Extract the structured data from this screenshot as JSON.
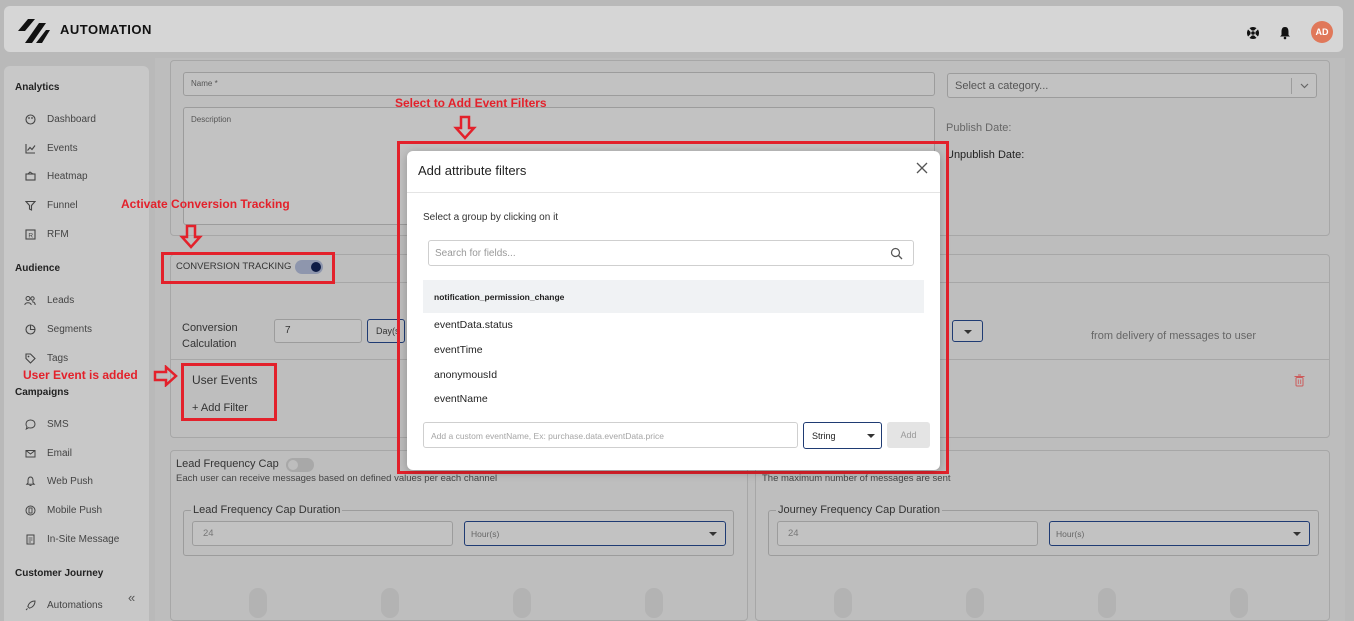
{
  "app": {
    "brand": "AUTOMATION",
    "avatar_initials": "AD"
  },
  "sidebar": {
    "sections": [
      {
        "label": "Analytics",
        "items": [
          {
            "label": "Dashboard",
            "icon": "palette-icon"
          },
          {
            "label": "Events",
            "icon": "line-chart-icon"
          },
          {
            "label": "Heatmap",
            "icon": "heatmap-icon"
          },
          {
            "label": "Funnel",
            "icon": "funnel-icon"
          },
          {
            "label": "RFM",
            "icon": "rfm-icon"
          }
        ]
      },
      {
        "label": "Audience",
        "items": [
          {
            "label": "Leads",
            "icon": "users-icon"
          },
          {
            "label": "Segments",
            "icon": "pie-icon"
          },
          {
            "label": "Tags",
            "icon": "tag-icon"
          }
        ]
      },
      {
        "label": "Campaigns",
        "items": [
          {
            "label": "SMS",
            "icon": "chat-icon"
          },
          {
            "label": "Email",
            "icon": "mail-icon"
          },
          {
            "label": "Web Push",
            "icon": "bell-icon"
          },
          {
            "label": "Mobile Push",
            "icon": "mobile-icon"
          },
          {
            "label": "In-Site Message",
            "icon": "doc-icon"
          }
        ]
      },
      {
        "label": "Customer Journey",
        "items": [
          {
            "label": "Automations",
            "icon": "rocket-icon"
          }
        ]
      }
    ],
    "collapse_glyph": "«"
  },
  "form": {
    "name_label": "Name *",
    "description_label": "Description",
    "category_placeholder": "Select a category...",
    "publish_date_label": "Publish Date:",
    "unpublish_date_label": "Unpublish Date:",
    "conversion_tracking_label": "CONVERSION TRACKING",
    "conversion_calc_label": "Conversion Calculation",
    "conversion_value": "7",
    "conversion_unit": "Day(s",
    "delivery_note": "from delivery of messages to user",
    "user_events_label": "User Events",
    "add_filter_label": "+ Add Filter",
    "lead_cap_title": "Lead Frequency Cap",
    "lead_cap_desc": "Each user can receive messages based on defined values per each channel",
    "journey_cap_desc": "The maximum number of messages are sent",
    "lead_cap_duration_label": "Lead Frequency Cap Duration",
    "journey_cap_duration_label": "Journey Frequency Cap Duration",
    "lead_cap_value": "24",
    "lead_cap_unit": "Hour(s)",
    "journey_cap_value": "24",
    "journey_cap_unit": "Hour(s)"
  },
  "annotations": {
    "select_filters": "Select to Add Event Filters",
    "activate_tracking": "Activate  Conversion Tracking",
    "user_event_added": "User Event is added",
    "color": "#e3212b"
  },
  "modal": {
    "title": "Add attribute filters",
    "subtitle": "Select a group by clicking on it",
    "search_placeholder": "Search for fields...",
    "group": "notification_permission_change",
    "options": [
      "eventData.status",
      "eventTime",
      "anonymousId",
      "eventName"
    ],
    "custom_placeholder": "Add a custom eventName, Ex: purchase.data.eventData.price",
    "type_value": "String",
    "add_label": "Add"
  }
}
